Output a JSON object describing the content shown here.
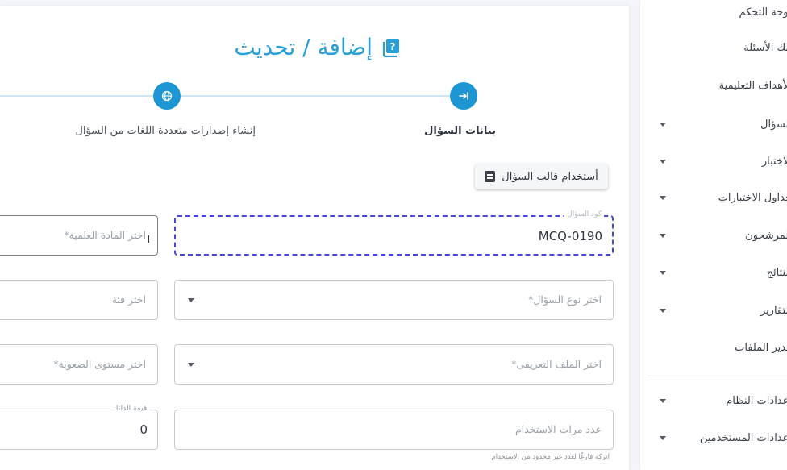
{
  "page": {
    "title": "إضافة / تحديث",
    "steps": [
      {
        "label": "بيانات السؤال",
        "active": true,
        "icon": "arrow-right-to-line-icon"
      },
      {
        "label": "إنشاء إصدارات متعددة اللغات من السؤال",
        "active": false,
        "icon": "globe-icon"
      }
    ]
  },
  "toolbar": {
    "template_label": "أستخدام قالب السؤال"
  },
  "form": {
    "code": {
      "label": "كود السؤال",
      "value": "MCQ-0190"
    },
    "subject": {
      "placeholder": "اختر المادة العلمية*"
    },
    "question_type": {
      "placeholder": "اختر نوع السؤال*"
    },
    "category": {
      "placeholder": "اختر فئة"
    },
    "profile": {
      "placeholder": "اختر الملف التعريفى*"
    },
    "difficulty": {
      "placeholder": "اختر مستوى الصعوبة*"
    },
    "usage_count": {
      "placeholder": "عدد مرات الاستخدام",
      "hint": "اتركه فارغًا لعدد غير محدود من الاستخدام"
    },
    "delta": {
      "label": "قيمة الدلتا",
      "value": "0"
    }
  },
  "sidebar": {
    "items": [
      {
        "label": "لوحة التحكم",
        "has_caret": false
      },
      {
        "label": "بنك الأسئلة",
        "has_caret": false
      },
      {
        "label": "الأهداف التعليمية",
        "has_caret": false
      },
      {
        "label": "السؤال",
        "has_caret": true
      },
      {
        "label": "الاختبار",
        "has_caret": true
      },
      {
        "label": "جداول الاختبارات",
        "has_caret": true
      },
      {
        "label": "المرشحون",
        "has_caret": true
      },
      {
        "label": "النتائج",
        "has_caret": true
      },
      {
        "label": "التقارير",
        "has_caret": true
      },
      {
        "label": "مدير الملفات",
        "has_caret": false
      },
      {
        "label": "إعدادات النظام",
        "has_caret": true
      },
      {
        "label": "إعدادات المستخدمين",
        "has_caret": true
      }
    ]
  },
  "colors": {
    "accent": "#1e96d4",
    "title": "#2a9fd6",
    "focus_border": "#4548d8"
  }
}
